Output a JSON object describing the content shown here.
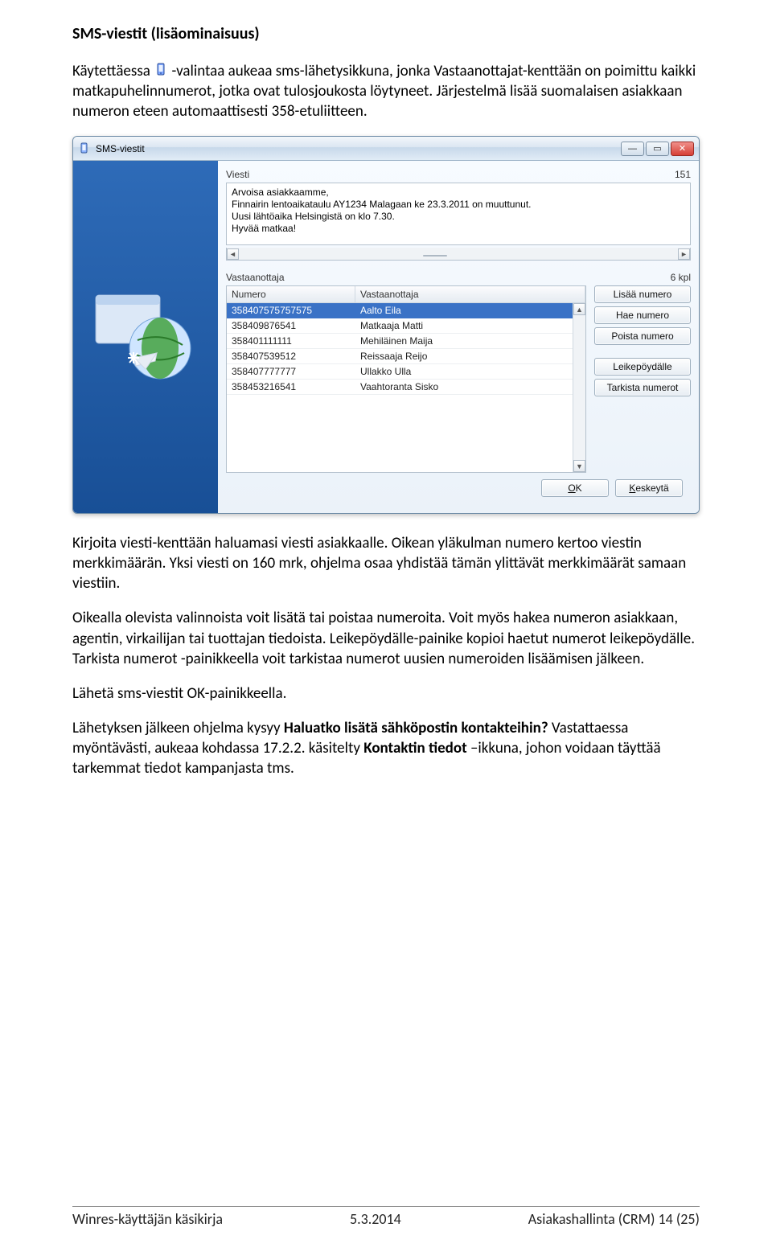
{
  "doc": {
    "heading": "SMS-viestit (lisäominaisuus)",
    "p1a": "Käytettäessa ",
    "p1b": " -valintaa aukeaa sms-lähetysikkuna, jonka Vastaanottajat-kenttään on poimittu kaikki matkapuhelinnumerot, jotka ovat tulosjoukosta löytyneet. Järjestelmä lisää suomalaisen asiakkaan numeron eteen automaattisesti 358-etuliitteen.",
    "p2": "Kirjoita viesti-kenttään haluamasi viesti asiakkaalle. Oikean yläkulman numero kertoo viestin merkkimäärän. Yksi viesti on 160 mrk, ohjelma osaa yhdistää tämän ylittävät merkkimäärät samaan viestiin.",
    "p3": "Oikealla olevista valinnoista voit lisätä tai poistaa numeroita. Voit myös hakea numeron asiakkaan, agentin, virkailijan tai tuottajan tiedoista. Leikepöydälle-painike kopioi haetut numerot leikepöydälle. Tarkista numerot -painikkeella voit tarkistaa numerot uusien numeroiden lisäämisen jälkeen.",
    "p4": "Lähetä sms-viestit OK-painikkeella.",
    "p5a": "Lähetyksen jälkeen ohjelma kysyy ",
    "p5b": "Haluatko lisätä sähköpostin kontakteihin?",
    "p5c": " Vastattaessa myöntävästi, aukeaa kohdassa 17.2.2. käsitelty ",
    "p5d": "Kontaktin tiedot",
    "p5e": " –ikkuna, johon voidaan täyttää tarkemmat tiedot kampanjasta tms."
  },
  "window": {
    "title": "SMS-viestit",
    "message_label": "Viesti",
    "char_count": "151",
    "message_text": "Arvoisa asiakkaamme,\nFinnairin lentoaikataulu AY1234 Malagaan ke 23.3.2011 on muuttunut.\nUusi lähtöaika Helsingistä on klo 7.30.\nHyvää matkaa!",
    "recipients_label": "Vastaanottaja",
    "recipients_count": "6 kpl",
    "columns": {
      "number": "Numero",
      "name": "Vastaanottaja"
    },
    "recipients": [
      {
        "number": "358407575757575",
        "name": "Aalto Eila"
      },
      {
        "number": "358409876541",
        "name": "Matkaaja Matti"
      },
      {
        "number": "358401111111",
        "name": "Mehiläinen Maija"
      },
      {
        "number": "358407539512",
        "name": "Reissaaja Reijo"
      },
      {
        "number": "358407777777",
        "name": "Ullakko Ulla"
      },
      {
        "number": "358453216541",
        "name": "Vaahtoranta Sisko"
      }
    ],
    "buttons": {
      "add": "Lisää numero",
      "find": "Hae numero",
      "remove": "Poista numero",
      "clipboard": "Leikepöydälle",
      "check": "Tarkista numerot",
      "ok_u": "O",
      "ok_rest": "K",
      "cancel_u": "K",
      "cancel_rest": "eskeytä"
    }
  },
  "footer": {
    "left": "Winres-käyttäjän käsikirja",
    "center": "5.3.2014",
    "right": "Asiakashallinta (CRM)  14 (25)"
  }
}
